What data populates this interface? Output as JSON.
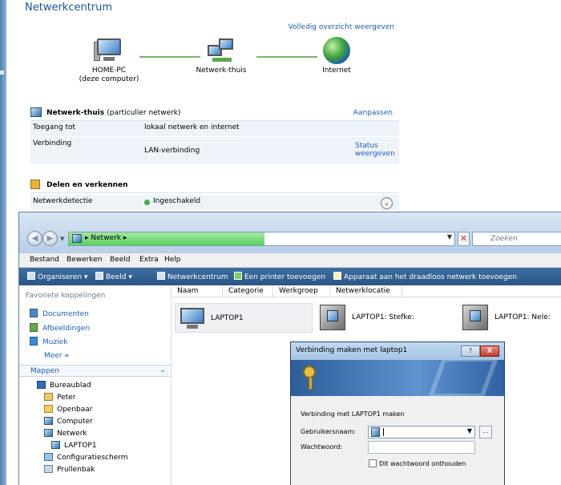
{
  "network_center": {
    "title": "Netwerkcentrum",
    "overview_link": "Volledig overzicht weergeven",
    "nodes": [
      {
        "name": "HOME-PC",
        "sub": "(deze computer)"
      },
      {
        "name": "Netwerk-thuis",
        "sub": ""
      },
      {
        "name": "Internet",
        "sub": ""
      }
    ],
    "network": {
      "name": "Netwerk-thuis",
      "type": "(particulier netwerk)",
      "customize": "Aanpassen",
      "access_label": "Toegang tot",
      "access_value": "lokaal netwerk en internet",
      "connection_label": "Verbinding",
      "connection_value": "LAN-verbinding",
      "status_line1": "Status",
      "status_line2": "weergeven"
    },
    "sharing": {
      "title": "Delen en verkennen",
      "discovery_label": "Netwerkdetectie",
      "discovery_value": "Ingeschakeld"
    }
  },
  "explorer": {
    "address": "Netwerk",
    "search_placeholder": "Zoeken",
    "menu": [
      "Bestand",
      "Bewerken",
      "Beeld",
      "Extra",
      "Help"
    ],
    "toolbar": [
      "Organiseren",
      "Beeld",
      "Netwerkcentrum",
      "Een printer toevoegen",
      "Apparaat aan het draadloos netwerk toevoegen"
    ],
    "favorites_title": "Favoriete koppelingen",
    "favorites": [
      "Documenten",
      "Afbeeldingen",
      "Muziek"
    ],
    "more": "Meer",
    "folders_title": "Mappen",
    "tree": [
      "Bureaublad",
      "Peter",
      "Openbaar",
      "Computer",
      "Netwerk",
      "LAPTOP1",
      "Configuratiescherm",
      "Prullenbak"
    ],
    "columns": [
      "Naam",
      "Categorie",
      "Werkgroep",
      "Netwerklocatie"
    ],
    "items": [
      "LAPTOP1",
      "LAPTOP1: Stefke:",
      "LAPTOP1: Nele:"
    ]
  },
  "dialog": {
    "title": "Verbinding maken met laptop1",
    "help": "?",
    "close": "X",
    "message": "Verbinding met LAPTOP1 maken",
    "username_label": "Gebruikersnaam:",
    "password_label": "Wachtwoord:",
    "remember": "Dit wachtwoord onthouden"
  }
}
